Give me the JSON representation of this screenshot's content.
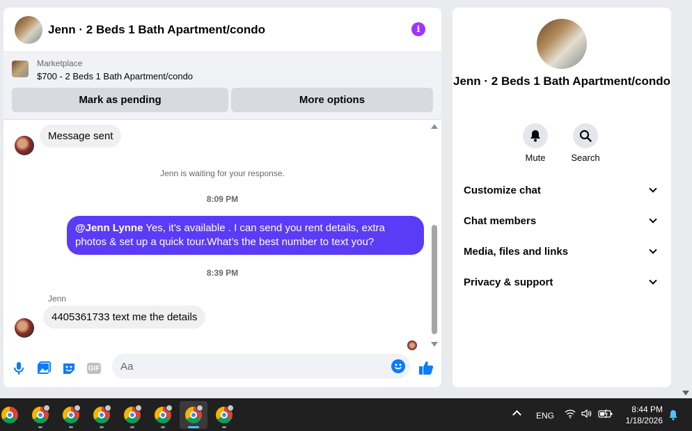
{
  "chat": {
    "title": "Jenn · 2 Beds 1 Bath Apartment/condo",
    "marketplace_label": "Marketplace",
    "marketplace_listing": "$700 - 2 Beds 1 Bath Apartment/condo",
    "mark_pending_label": "Mark as pending",
    "more_options_label": "More options",
    "messages": {
      "m1": "Message sent",
      "system": "Jenn is waiting for your response.",
      "time1": "8:09 PM",
      "out_mention": "@Jenn Lynne",
      "out_text": " Yes, it’s available .  I can send you rent details, extra photos & set up a quick tour.What’s the best number to text you?",
      "time2": "8:39 PM",
      "sender": "Jenn",
      "m2": "4405361733 text me the details"
    },
    "composer_placeholder": "Aa",
    "gif_label": "GIF"
  },
  "info": {
    "name": "Jenn · 2 Beds 1 Bath Apartment/condo",
    "mute_label": "Mute",
    "search_label": "Search",
    "menu": [
      "Customize chat",
      "Chat members",
      "Media, files and links",
      "Privacy & support"
    ]
  },
  "taskbar": {
    "lang": "ENG",
    "time": "8:44 PM",
    "date": "1/18/2026"
  },
  "colors": {
    "accent": "#0a7cff",
    "outgoing_bubble": "#5b3cf6",
    "info_icon": "#a033ff"
  }
}
